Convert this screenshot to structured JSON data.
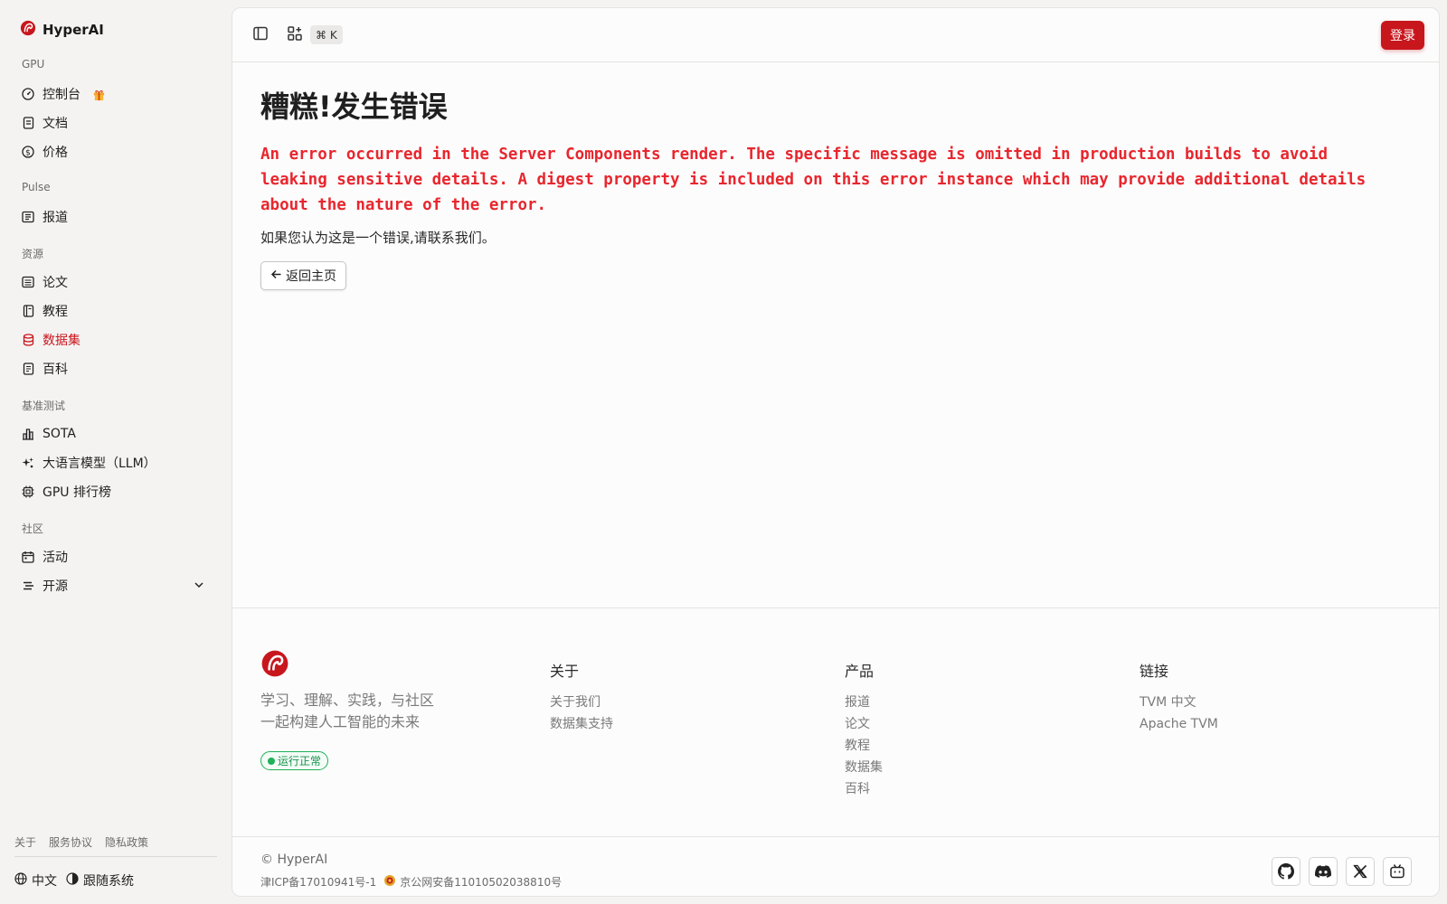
{
  "brand": {
    "name": "HyperAI"
  },
  "sidebar": {
    "sections": {
      "gpu": "GPU",
      "pulse": "Pulse",
      "resources": "资源",
      "benchmark": "基准测试",
      "community": "社区"
    },
    "items": {
      "console": "控制台",
      "docs": "文档",
      "pricing": "价格",
      "news": "报道",
      "papers": "论文",
      "tutorials": "教程",
      "datasets": "数据集",
      "wiki": "百科",
      "sota": "SOTA",
      "llm": "大语言模型（LLM）",
      "gpu_rank": "GPU 排行榜",
      "events": "活动",
      "opensource": "开源"
    },
    "active_item": "datasets",
    "footer_links": [
      "关于",
      "服务协议",
      "隐私政策"
    ],
    "language": "中文",
    "theme": "跟随系统"
  },
  "topbar": {
    "shortcut": "⌘ K",
    "login_label": "登录"
  },
  "error": {
    "title": "糟糕!发生错误",
    "message": "An error occurred in the Server Components render. The specific message is omitted in production builds to avoid leaking sensitive details. A digest property is included on this error instance which may provide additional details about the nature of the error.",
    "hint": "如果您认为这是一个错误,请联系我们。",
    "back_label": "返回主页"
  },
  "footer": {
    "tagline_1": "学习、理解、实践，与社区",
    "tagline_2": "一起构建人工智能的未来",
    "status": "运行正常",
    "columns": [
      {
        "title": "关于",
        "links": [
          "关于我们",
          "数据集支持"
        ]
      },
      {
        "title": "产品",
        "links": [
          "报道",
          "论文",
          "教程",
          "数据集",
          "百科"
        ]
      },
      {
        "title": "链接",
        "links": [
          "TVM 中文",
          "Apache TVM"
        ]
      }
    ],
    "copyright": "© HyperAI",
    "icp": "津ICP备17010941号-1",
    "police": "京公网安备11010502038810号"
  },
  "colors": {
    "accent": "#c8161d",
    "error": "#e8262e",
    "status": "#20b15a"
  }
}
